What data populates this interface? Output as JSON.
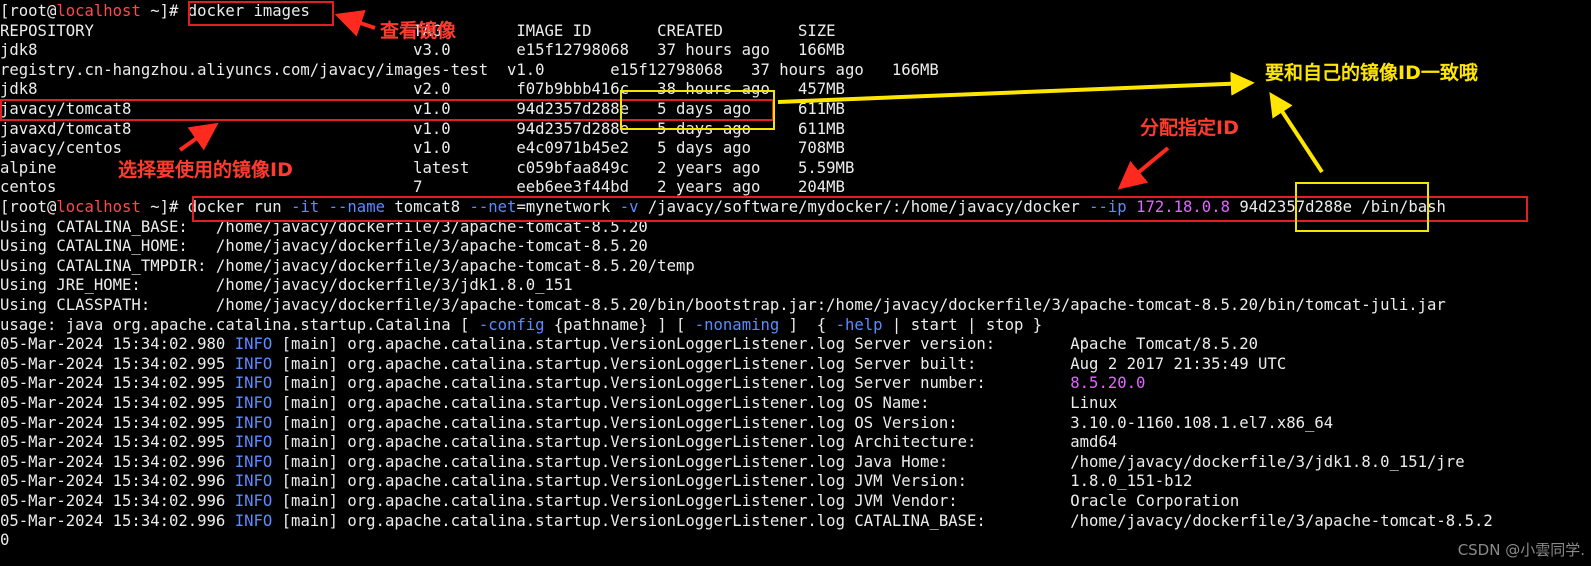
{
  "terminal": {
    "lines": [
      {
        "segs": [
          {
            "t": "[root@",
            "c": "white"
          },
          {
            "t": "localhost",
            "c": "red"
          },
          {
            "t": " ~]# ",
            "c": "white"
          },
          {
            "t": "docker images",
            "c": "white"
          }
        ]
      },
      {
        "segs": [
          {
            "t": "REPOSITORY                                  TAG        IMAGE ID       CREATED        SIZE",
            "c": "white"
          }
        ]
      },
      {
        "segs": [
          {
            "t": "jdk8                                        v3.0       e15f12798068   37 hours ago   166MB",
            "c": "white"
          }
        ]
      },
      {
        "segs": [
          {
            "t": "registry.cn-hangzhou.aliyuncs.com/javacy/images-test  v1.0       e15f12798068   37 hours ago   166MB",
            "c": "white"
          }
        ]
      },
      {
        "segs": [
          {
            "t": "jdk8                                        v2.0       f07b9bbb416c   38 hours ago   457MB",
            "c": "white"
          }
        ]
      },
      {
        "segs": [
          {
            "t": "javacy/tomcat8                              v1.0       94d2357d288e   5 days ago     611MB",
            "c": "white"
          }
        ]
      },
      {
        "segs": [
          {
            "t": "javaxd/tomcat8                              v1.0       94d2357d288e   5 days ago     611MB",
            "c": "white"
          }
        ]
      },
      {
        "segs": [
          {
            "t": "javacy/centos                               v1.0       e4c0971b45e2   5 days ago     708MB",
            "c": "white"
          }
        ]
      },
      {
        "segs": [
          {
            "t": "alpine                                      latest     c059bfaa849c   2 years ago    5.59MB",
            "c": "white"
          }
        ]
      },
      {
        "segs": [
          {
            "t": "centos                                      7          eeb6ee3f44bd   2 years ago    204MB",
            "c": "white"
          }
        ]
      },
      {
        "segs": [
          {
            "t": "[root@",
            "c": "white"
          },
          {
            "t": "localhost",
            "c": "red"
          },
          {
            "t": " ~]# ",
            "c": "white"
          },
          {
            "t": "docker run ",
            "c": "white"
          },
          {
            "t": "-it",
            "c": "blue"
          },
          {
            "t": " ",
            "c": "white"
          },
          {
            "t": "--name",
            "c": "blue"
          },
          {
            "t": " tomcat8 ",
            "c": "white"
          },
          {
            "t": "--net",
            "c": "blue"
          },
          {
            "t": "=mynetwork ",
            "c": "white"
          },
          {
            "t": "-v",
            "c": "blue"
          },
          {
            "t": " /javacy/software/mydocker/:/home/javacy/docker ",
            "c": "white"
          },
          {
            "t": "--ip",
            "c": "blue"
          },
          {
            "t": " 172.18.0.8",
            "c": "magenta"
          },
          {
            "t": " 94d2357d288e /bin/bash",
            "c": "white"
          }
        ]
      },
      {
        "segs": [
          {
            "t": "Using CATALINA_BASE:   /home/javacy/dockerfile/3/apache-tomcat-8.5.20",
            "c": "white"
          }
        ]
      },
      {
        "segs": [
          {
            "t": "Using CATALINA_HOME:   /home/javacy/dockerfile/3/apache-tomcat-8.5.20",
            "c": "white"
          }
        ]
      },
      {
        "segs": [
          {
            "t": "Using CATALINA_TMPDIR: /home/javacy/dockerfile/3/apache-tomcat-8.5.20/temp",
            "c": "white"
          }
        ]
      },
      {
        "segs": [
          {
            "t": "Using JRE_HOME:        /home/javacy/dockerfile/3/jdk1.8.0_151",
            "c": "white"
          }
        ]
      },
      {
        "segs": [
          {
            "t": "Using CLASSPATH:       /home/javacy/dockerfile/3/apache-tomcat-8.5.20/bin/bootstrap.jar:/home/javacy/dockerfile/3/apache-tomcat-8.5.20/bin/tomcat-juli.jar",
            "c": "white"
          }
        ]
      },
      {
        "segs": [
          {
            "t": "usage: java org.apache.catalina.startup.Catalina [ ",
            "c": "white"
          },
          {
            "t": "-config",
            "c": "blue"
          },
          {
            "t": " {pathname} ] [ ",
            "c": "white"
          },
          {
            "t": "-nonaming",
            "c": "blue"
          },
          {
            "t": " ]  { ",
            "c": "white"
          },
          {
            "t": "-help",
            "c": "blue"
          },
          {
            "t": " | start | stop }",
            "c": "white"
          }
        ]
      },
      {
        "segs": [
          {
            "t": "05-Mar-2024 15:34:02.980 ",
            "c": "white"
          },
          {
            "t": "INFO",
            "c": "blue"
          },
          {
            "t": " [main] org.apache.catalina.startup.VersionLoggerListener.log Server version:        Apache Tomcat/8.5.20",
            "c": "white"
          }
        ]
      },
      {
        "segs": [
          {
            "t": "05-Mar-2024 15:34:02.995 ",
            "c": "white"
          },
          {
            "t": "INFO",
            "c": "blue"
          },
          {
            "t": " [main] org.apache.catalina.startup.VersionLoggerListener.log Server built:          Aug 2 2017 21:35:49 UTC",
            "c": "white"
          }
        ]
      },
      {
        "segs": [
          {
            "t": "05-Mar-2024 15:34:02.995 ",
            "c": "white"
          },
          {
            "t": "INFO",
            "c": "blue"
          },
          {
            "t": " [main] org.apache.catalina.startup.VersionLoggerListener.log Server number:         ",
            "c": "white"
          },
          {
            "t": "8.5.20.0",
            "c": "magenta"
          }
        ]
      },
      {
        "segs": [
          {
            "t": "05-Mar-2024 15:34:02.995 ",
            "c": "white"
          },
          {
            "t": "INFO",
            "c": "blue"
          },
          {
            "t": " [main] org.apache.catalina.startup.VersionLoggerListener.log OS Name:               Linux",
            "c": "white"
          }
        ]
      },
      {
        "segs": [
          {
            "t": "05-Mar-2024 15:34:02.995 ",
            "c": "white"
          },
          {
            "t": "INFO",
            "c": "blue"
          },
          {
            "t": " [main] org.apache.catalina.startup.VersionLoggerListener.log OS Version:            3.10.0-1160.108.1.el7.x86_64",
            "c": "white"
          }
        ]
      },
      {
        "segs": [
          {
            "t": "05-Mar-2024 15:34:02.995 ",
            "c": "white"
          },
          {
            "t": "INFO",
            "c": "blue"
          },
          {
            "t": " [main] org.apache.catalina.startup.VersionLoggerListener.log Architecture:          amd64",
            "c": "white"
          }
        ]
      },
      {
        "segs": [
          {
            "t": "05-Mar-2024 15:34:02.996 ",
            "c": "white"
          },
          {
            "t": "INFO",
            "c": "blue"
          },
          {
            "t": " [main] org.apache.catalina.startup.VersionLoggerListener.log Java Home:             /home/javacy/dockerfile/3/jdk1.8.0_151/jre",
            "c": "white"
          }
        ]
      },
      {
        "segs": [
          {
            "t": "05-Mar-2024 15:34:02.996 ",
            "c": "white"
          },
          {
            "t": "INFO",
            "c": "blue"
          },
          {
            "t": " [main] org.apache.catalina.startup.VersionLoggerListener.log JVM Version:           1.8.0_151-b12",
            "c": "white"
          }
        ]
      },
      {
        "segs": [
          {
            "t": "05-Mar-2024 15:34:02.996 ",
            "c": "white"
          },
          {
            "t": "INFO",
            "c": "blue"
          },
          {
            "t": " [main] org.apache.catalina.startup.VersionLoggerListener.log JVM Vendor:            Oracle Corporation",
            "c": "white"
          }
        ]
      },
      {
        "segs": [
          {
            "t": "05-Mar-2024 15:34:02.996 ",
            "c": "white"
          },
          {
            "t": "INFO",
            "c": "blue"
          },
          {
            "t": " [main] org.apache.catalina.startup.VersionLoggerListener.log CATALINA_BASE:         /home/javacy/dockerfile/3/apache-tomcat-8.5.2",
            "c": "white"
          }
        ]
      },
      {
        "segs": [
          {
            "t": "0",
            "c": "white"
          }
        ]
      }
    ]
  },
  "annotations": {
    "view_images": "查看镜像",
    "select_image_id": "选择要使用的镜像ID",
    "assign_ip": "分配指定ID",
    "match_image_id": "要和自己的镜像ID一致哦"
  },
  "watermark": "CSDN @小雲同学.",
  "colors": {
    "background": "#000000",
    "text": "#ececec",
    "hostname": "#ff4a4a",
    "option": "#5a8cff",
    "value": "#e066ff",
    "annotation_red": "#ff3b2f",
    "annotation_yellow": "#ffe600"
  }
}
